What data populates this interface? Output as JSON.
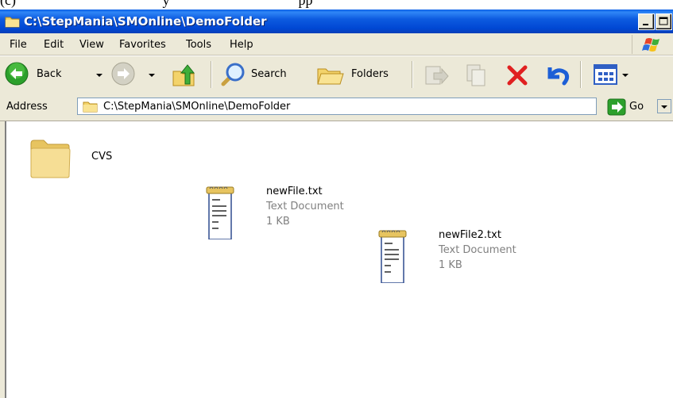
{
  "caption": "(c)                                         y                                    pp",
  "window": {
    "title": "C:\\StepMania\\SMOnline\\DemoFolder"
  },
  "menu": [
    "File",
    "Edit",
    "View",
    "Favorites",
    "Tools",
    "Help"
  ],
  "toolbar": {
    "back_label": "Back",
    "search_label": "Search",
    "folders_label": "Folders"
  },
  "address": {
    "label": "Address",
    "value": "C:\\StepMania\\SMOnline\\DemoFolder",
    "go_label": "Go"
  },
  "items": [
    {
      "name": "CVS",
      "kind": "folder"
    },
    {
      "name": "newFile.txt",
      "type": "Text Document",
      "size": "1 KB",
      "kind": "text"
    },
    {
      "name": "newFile2.txt",
      "type": "Text Document",
      "size": "1 KB",
      "kind": "text"
    }
  ],
  "colors": {
    "titlebar": "#0047d3",
    "chrome": "#ece9d8",
    "close_x": "#e02020",
    "arrow_green": "#2ca02c",
    "undo_blue": "#1d5fd6"
  }
}
